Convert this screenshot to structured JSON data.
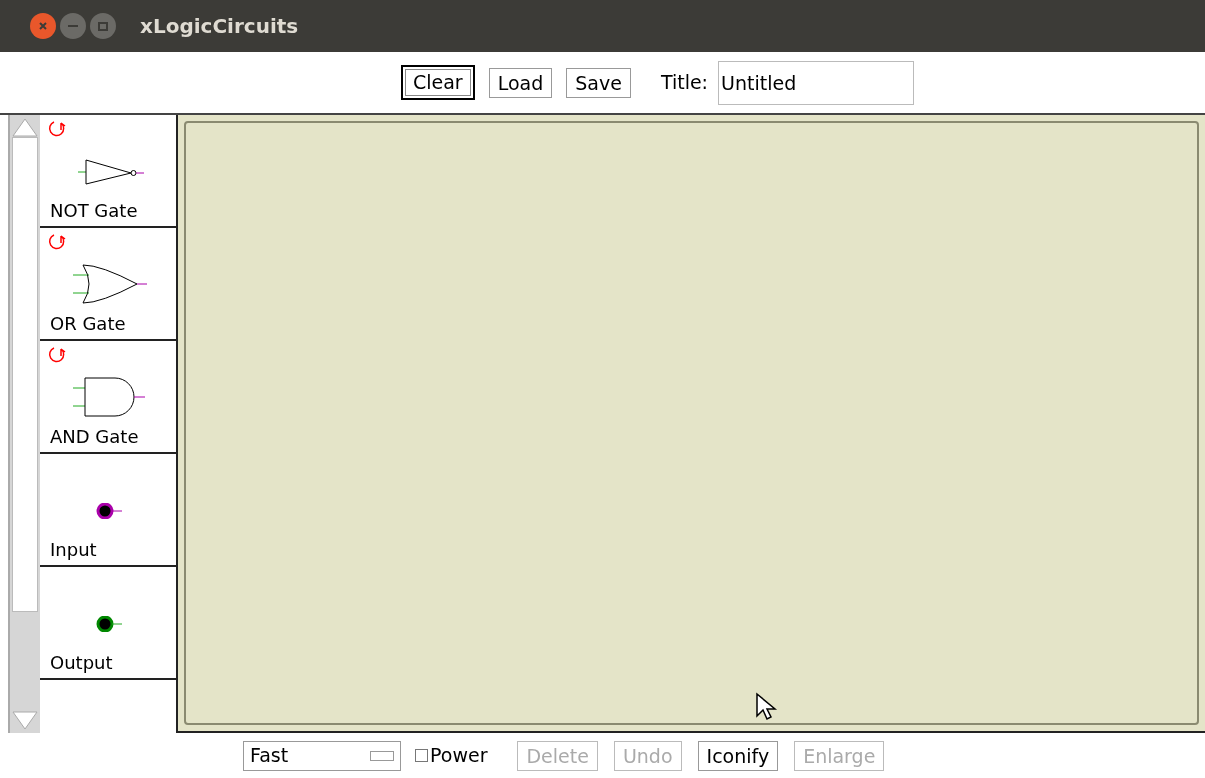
{
  "window": {
    "title": "xLogicCircuits"
  },
  "toolbar": {
    "buttons": [
      {
        "label": "Clear",
        "focused": true
      },
      {
        "label": "Load",
        "focused": false
      },
      {
        "label": "Save",
        "focused": false
      }
    ],
    "title_label": "Title:",
    "title_value": "Untitled"
  },
  "palette": [
    {
      "kind": "not",
      "label": "NOT Gate"
    },
    {
      "kind": "or",
      "label": "OR Gate"
    },
    {
      "kind": "and",
      "label": "AND Gate"
    },
    {
      "kind": "input",
      "label": "Input"
    },
    {
      "kind": "output",
      "label": "Output"
    }
  ],
  "bottom": {
    "speed": "Fast",
    "power": {
      "label": "Power",
      "checked": false
    },
    "buttons": [
      {
        "label": "Delete",
        "disabled": true
      },
      {
        "label": "Undo",
        "disabled": true
      },
      {
        "label": "Iconify",
        "disabled": false
      },
      {
        "label": "Enlarge",
        "disabled": true
      }
    ]
  }
}
